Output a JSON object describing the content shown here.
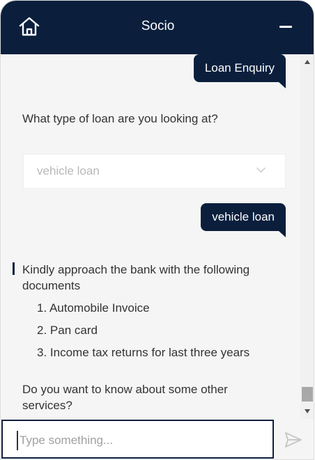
{
  "header": {
    "title": "Socio",
    "home_icon": "home-icon",
    "minimize_icon": "minimize-icon",
    "bg_color": "#0b1f3d"
  },
  "messages": {
    "user_1": "Loan Enquiry",
    "bot_1": "What type of loan are you looking at?",
    "dropdown_value": "vehicle loan",
    "user_2": "vehicle loan",
    "bot_2_intro": "Kindly approach the bank with the following documents",
    "documents": [
      "1. Automobile Invoice",
      "2. Pan card",
      "3. Income tax returns for last three years"
    ],
    "bot_3": "Do you want to know about some other services?"
  },
  "input": {
    "placeholder": "Type something...",
    "send_icon": "send-icon"
  }
}
